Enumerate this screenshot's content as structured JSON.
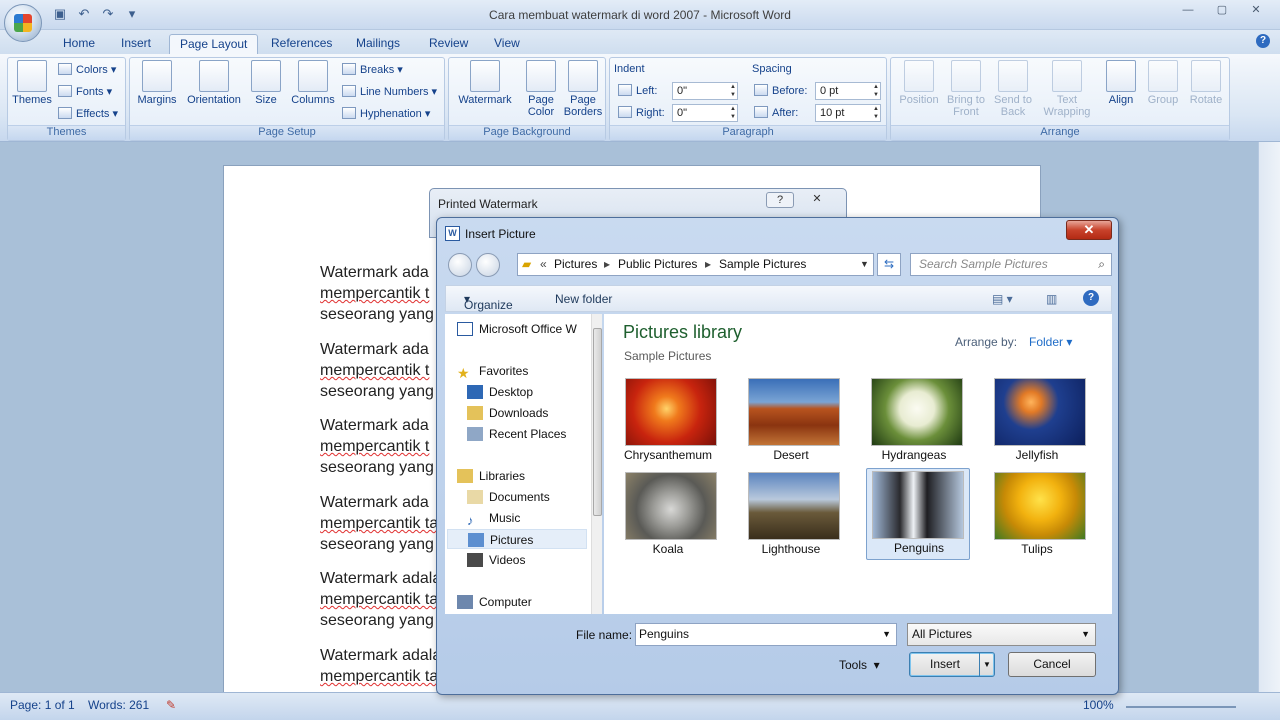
{
  "window": {
    "title": "Cara membuat watermark di word 2007 - Microsoft Word"
  },
  "tabs": [
    "Home",
    "Insert",
    "Page Layout",
    "References",
    "Mailings",
    "Review",
    "View"
  ],
  "active_tab": "Page Layout",
  "ribbon": {
    "themes": {
      "themes": "Themes",
      "colors": "Colors",
      "fonts": "Fonts",
      "effects": "Effects",
      "group": "Themes"
    },
    "page_setup": {
      "margins": "Margins",
      "orientation": "Orientation",
      "size": "Size",
      "columns": "Columns",
      "breaks": "Breaks",
      "line_numbers": "Line Numbers",
      "hyphenation": "Hyphenation",
      "group": "Page Setup"
    },
    "page_background": {
      "watermark": "Watermark",
      "page_color_1": "Page",
      "page_color_2": "Color",
      "page_borders_1": "Page",
      "page_borders_2": "Borders",
      "group": "Page Background"
    },
    "paragraph": {
      "indent": "Indent",
      "left": "Left:",
      "left_val": "0\"",
      "right": "Right:",
      "right_val": "0\"",
      "spacing": "Spacing",
      "before": "Before:",
      "before_val": "0 pt",
      "after": "After:",
      "after_val": "10 pt",
      "group": "Paragraph"
    },
    "arrange": {
      "position": "Position",
      "bring_1": "Bring to",
      "bring_2": "Front",
      "send_1": "Send to",
      "send_2": "Back",
      "text_1": "Text",
      "text_2": "Wrapping",
      "align": "Align",
      "group_btn": "Group",
      "rotate": "Rotate",
      "group": "Arrange"
    }
  },
  "document": {
    "paragraphs": [
      [
        "Watermark ada",
        "mempercantik t",
        "seseorang yang"
      ],
      [
        "Watermark ada",
        "mempercantik t",
        "seseorang yang"
      ],
      [
        "Watermark ada",
        "mempercantik t",
        "seseorang yang"
      ],
      [
        "Watermark ada",
        "mempercantik ta",
        "seseorang yang"
      ],
      [
        "Watermark adala",
        "mempercantik ta",
        "seseorang yang"
      ],
      [
        "Watermark adala",
        "mempercantik ta"
      ]
    ]
  },
  "status": {
    "page": "Page: 1 of 1",
    "words": "Words: 261",
    "zoom": "100%"
  },
  "printed_watermark": {
    "title": "Printed Watermark",
    "help": "?",
    "close": "✕"
  },
  "insert_picture": {
    "title": "Insert Picture",
    "breadcrumb": [
      "Pictures",
      "Public Pictures",
      "Sample Pictures"
    ],
    "search_placeholder": "Search Sample Pictures",
    "organize": "Organize",
    "new_folder": "New folder",
    "nav": {
      "office": "Microsoft Office W",
      "favorites": "Favorites",
      "desktop": "Desktop",
      "downloads": "Downloads",
      "recent": "Recent Places",
      "libraries": "Libraries",
      "documents": "Documents",
      "music": "Music",
      "pictures": "Pictures",
      "videos": "Videos",
      "computer": "Computer"
    },
    "library_title": "Pictures library",
    "library_sub": "Sample Pictures",
    "arrange_by": "Arrange by:",
    "arrange_value": "Folder",
    "thumbnails": [
      "Chrysanthemum",
      "Desert",
      "Hydrangeas",
      "Jellyfish",
      "Koala",
      "Lighthouse",
      "Penguins",
      "Tulips"
    ],
    "selected": "Penguins",
    "file_name_label": "File name:",
    "file_name": "Penguins",
    "file_type": "All Pictures",
    "tools": "Tools",
    "insert": "Insert",
    "cancel": "Cancel"
  }
}
